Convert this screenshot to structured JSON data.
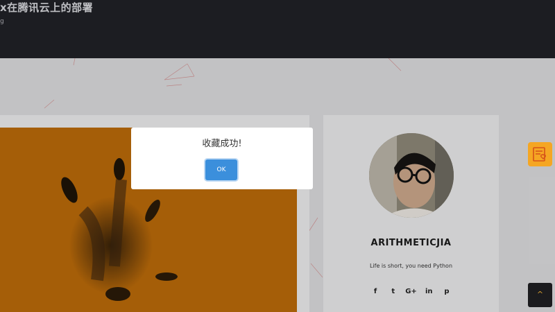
{
  "header": {
    "title": "x在腾讯云上的部署",
    "sub": "g"
  },
  "sidebar": {
    "author": "ARITHMETICJIA",
    "tagline": "Life is short, you need Python",
    "social": [
      "f",
      "t",
      "G+",
      "in",
      "p"
    ]
  },
  "modal": {
    "message": "收藏成功!",
    "ok_label": "OK"
  },
  "floating": {
    "top_label": "^",
    "accent": "#f5a623"
  },
  "icons": {
    "favorite": "favorite-list-icon",
    "back_to_top": "chevron-up-icon"
  }
}
